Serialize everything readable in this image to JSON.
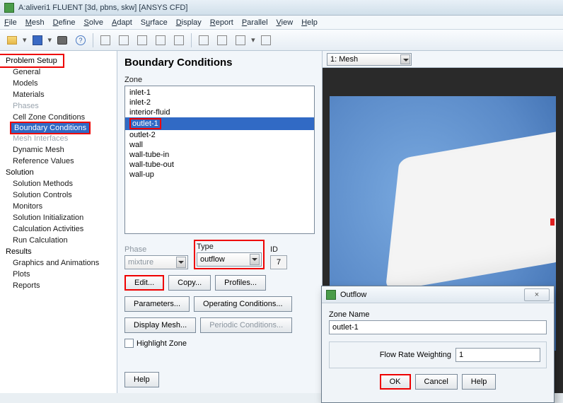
{
  "window": {
    "title": "A:aliveri1 FLUENT  [3d, pbns, skw] [ANSYS CFD]"
  },
  "menu": {
    "file": "File",
    "mesh": "Mesh",
    "define": "Define",
    "solve": "Solve",
    "adapt": "Adapt",
    "surface": "Surface",
    "display": "Display",
    "report": "Report",
    "parallel": "Parallel",
    "view": "View",
    "help": "Help"
  },
  "nav": {
    "problem_setup": "Problem Setup",
    "general": "General",
    "models": "Models",
    "materials": "Materials",
    "phases": "Phases",
    "cellzone": "Cell Zone Conditions",
    "bc": "Boundary Conditions",
    "meshif": "Mesh Interfaces",
    "dynmesh": "Dynamic Mesh",
    "refvals": "Reference Values",
    "solution": "Solution",
    "smethods": "Solution Methods",
    "scontrols": "Solution Controls",
    "monitors": "Monitors",
    "sinit": "Solution Initialization",
    "calcact": "Calculation Activities",
    "runcalc": "Run Calculation",
    "results": "Results",
    "gfx": "Graphics and Animations",
    "plots": "Plots",
    "reports": "Reports"
  },
  "task": {
    "heading": "Boundary Conditions",
    "zone_label": "Zone",
    "zones": [
      "inlet-1",
      "inlet-2",
      "interior-fluid",
      "outlet-1",
      "outlet-2",
      "wall",
      "wall-tube-in",
      "wall-tube-out",
      "wall-up"
    ],
    "selected_zone": "outlet-1",
    "phase_label": "Phase",
    "phase_value": "mixture",
    "type_label": "Type",
    "type_value": "outflow",
    "id_label": "ID",
    "id_value": "7",
    "btn_edit": "Edit...",
    "btn_copy": "Copy...",
    "btn_profiles": "Profiles...",
    "btn_params": "Parameters...",
    "btn_opcond": "Operating Conditions...",
    "btn_dispmesh": "Display Mesh...",
    "btn_periodic": "Periodic Conditions...",
    "chk_highlight": "Highlight Zone",
    "btn_help": "Help"
  },
  "viewport": {
    "combo": "1: Mesh",
    "caption": "Mesh"
  },
  "dialog": {
    "title": "Outflow",
    "zone_name_label": "Zone Name",
    "zone_name_value": "outlet-1",
    "frw_label": "Flow Rate Weighting",
    "frw_value": "1",
    "ok": "OK",
    "cancel": "Cancel",
    "help": "Help",
    "close": "×"
  }
}
